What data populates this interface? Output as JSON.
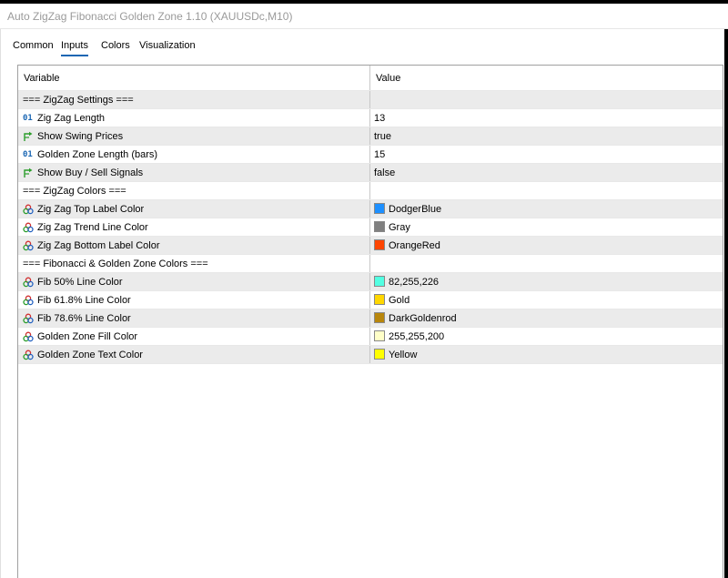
{
  "window": {
    "title": "Auto ZigZag Fibonacci Golden Zone 1.10 (XAUUSDc,M10)"
  },
  "tabs": [
    {
      "label": "Common",
      "active": false
    },
    {
      "label": "Inputs",
      "active": true
    },
    {
      "label": "Colors",
      "active": false
    },
    {
      "label": "Visualization",
      "active": false
    }
  ],
  "table": {
    "headers": {
      "variable": "Variable",
      "value": "Value"
    },
    "rows": [
      {
        "type": "section",
        "variable": "=== ZigZag Settings ===",
        "value": ""
      },
      {
        "type": "int",
        "icon": "integer-icon",
        "badge": "01",
        "variable": "Zig Zag Length",
        "value": "13"
      },
      {
        "type": "bool",
        "icon": "bool-arrow-icon",
        "variable": "Show Swing Prices",
        "value": "true"
      },
      {
        "type": "int",
        "icon": "integer-icon",
        "badge": "01",
        "variable": "Golden Zone Length (bars)",
        "value": "15"
      },
      {
        "type": "bool",
        "icon": "bool-arrow-icon",
        "variable": "Show Buy / Sell Signals",
        "value": "false"
      },
      {
        "type": "section",
        "variable": "=== ZigZag Colors ===",
        "value": ""
      },
      {
        "type": "color",
        "icon": "color-palette-icon",
        "variable": "Zig Zag Top Label Color",
        "value": "DodgerBlue",
        "swatch": "#1e90ff"
      },
      {
        "type": "color",
        "icon": "color-palette-icon",
        "variable": "Zig Zag Trend Line Color",
        "value": "Gray",
        "swatch": "#808080"
      },
      {
        "type": "color",
        "icon": "color-palette-icon",
        "variable": "Zig Zag Bottom Label Color",
        "value": "OrangeRed",
        "swatch": "#ff4500"
      },
      {
        "type": "section",
        "variable": "=== Fibonacci & Golden Zone Colors ===",
        "value": ""
      },
      {
        "type": "color",
        "icon": "color-palette-icon",
        "variable": "Fib 50% Line Color",
        "value": "82,255,226",
        "swatch": "#52ffe2"
      },
      {
        "type": "color",
        "icon": "color-palette-icon",
        "variable": "Fib 61.8% Line Color",
        "value": "Gold",
        "swatch": "#ffd700"
      },
      {
        "type": "color",
        "icon": "color-palette-icon",
        "variable": "Fib 78.6% Line Color",
        "value": "DarkGoldenrod",
        "swatch": "#b8860b"
      },
      {
        "type": "color",
        "icon": "color-palette-icon",
        "variable": "Golden Zone Fill Color",
        "value": "255,255,200",
        "swatch": "#ffffc8"
      },
      {
        "type": "color",
        "icon": "color-palette-icon",
        "variable": "Golden Zone Text Color",
        "value": "Yellow",
        "swatch": "#ffff00"
      }
    ]
  }
}
